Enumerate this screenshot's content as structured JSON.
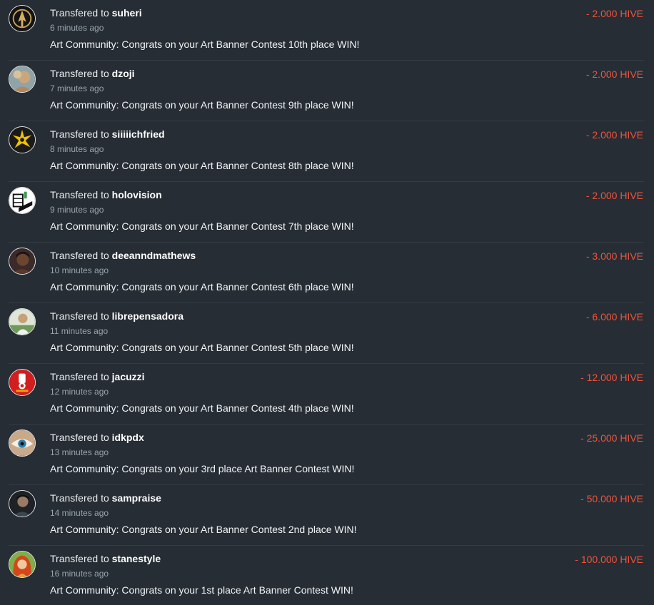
{
  "colors": {
    "background": "#262d34",
    "amount": "#f0533d",
    "separator": "#343c44"
  },
  "transfers": [
    {
      "prefix": "Transfered to",
      "user": "suheri",
      "time": "6 minutes ago",
      "memo": "Art Community: Congrats on your Art Banner Contest 10th place WIN!",
      "amount": "- 2.000 HIVE",
      "avatar_icon": "gold-emblem-avatar"
    },
    {
      "prefix": "Transfered to",
      "user": "dzoji",
      "time": "7 minutes ago",
      "memo": "Art Community: Congrats on your Art Banner Contest 9th place WIN!",
      "amount": "- 2.000 HIVE",
      "avatar_icon": "portrait-avatar"
    },
    {
      "prefix": "Transfered to",
      "user": "siiiiichfried",
      "time": "8 minutes ago",
      "memo": "Art Community: Congrats on your Art Banner Contest 8th place WIN!",
      "amount": "- 2.000 HIVE",
      "avatar_icon": "yellow-star-avatar"
    },
    {
      "prefix": "Transfered to",
      "user": "holovision",
      "time": "9 minutes ago",
      "memo": "Art Community: Congrats on your Art Banner Contest 7th place WIN!",
      "amount": "- 2.000 HIVE",
      "avatar_icon": "building-avatar"
    },
    {
      "prefix": "Transfered to",
      "user": "deeanndmathews",
      "time": "10 minutes ago",
      "memo": "Art Community: Congrats on your Art Banner Contest 6th place WIN!",
      "amount": "- 3.000 HIVE",
      "avatar_icon": "portrait-avatar"
    },
    {
      "prefix": "Transfered to",
      "user": "librepensadora",
      "time": "11 minutes ago",
      "memo": "Art Community: Congrats on your Art Banner Contest 5th place WIN!",
      "amount": "- 6.000 HIVE",
      "avatar_icon": "portrait-avatar"
    },
    {
      "prefix": "Transfered to",
      "user": "jacuzzi",
      "time": "12 minutes ago",
      "memo": "Art Community: Congrats on your Art Banner Contest 4th place WIN!",
      "amount": "- 12.000 HIVE",
      "avatar_icon": "red-fist-avatar"
    },
    {
      "prefix": "Transfered to",
      "user": "idkpdx",
      "time": "13 minutes ago",
      "memo": "Art Community: Congrats on your 3rd place Art Banner Contest WIN!",
      "amount": "- 25.000 HIVE",
      "avatar_icon": "eye-avatar"
    },
    {
      "prefix": "Transfered to",
      "user": "sampraise",
      "time": "14 minutes ago",
      "memo": "Art Community: Congrats on your Art Banner Contest 2nd place WIN!",
      "amount": "- 50.000 HIVE",
      "avatar_icon": "portrait-avatar"
    },
    {
      "prefix": "Transfered to",
      "user": "stanestyle",
      "time": "16 minutes ago",
      "memo": "Art Community: Congrats on your 1st place Art Banner Contest WIN!",
      "amount": "- 100.000 HIVE",
      "avatar_icon": "red-hair-avatar"
    }
  ]
}
